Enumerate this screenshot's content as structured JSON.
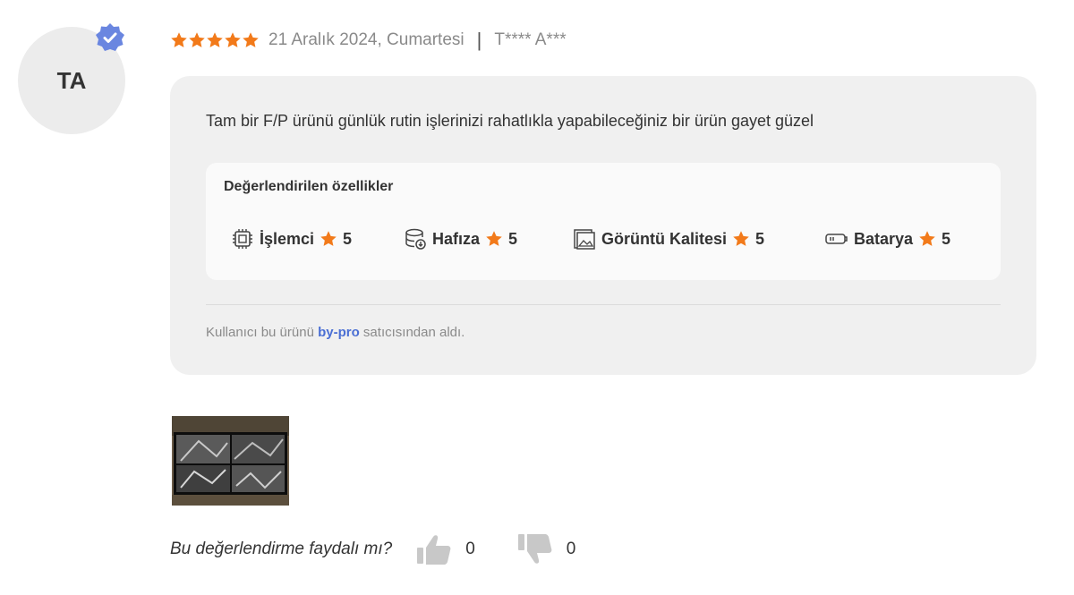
{
  "user": {
    "initials": "TA",
    "verified_icon": "verified-badge-icon",
    "masked_name": "T**** A***"
  },
  "review": {
    "rating": 5,
    "date": "21 Aralık 2024, Cumartesi",
    "separator": "|",
    "text": "Tam bir F/P ürünü günlük rutin işlerinizi rahatlıkla yapabileceğiniz bir ürün gayet güzel"
  },
  "features": {
    "title": "Değerlendirilen özellikler",
    "items": [
      {
        "icon": "cpu-icon",
        "label": "İşlemci",
        "score": "5"
      },
      {
        "icon": "storage-icon",
        "label": "Hafıza",
        "score": "5"
      },
      {
        "icon": "image-icon",
        "label": "Görüntü Kalitesi",
        "score": "5"
      },
      {
        "icon": "battery-icon",
        "label": "Batarya",
        "score": "5"
      }
    ]
  },
  "seller": {
    "prefix": "Kullanıcı bu ürünü ",
    "store": "by-pro",
    "suffix": " satıcısından aldı."
  },
  "helpful": {
    "question": "Bu değerlendirme faydalı mı?",
    "up_count": "0",
    "down_count": "0"
  },
  "colors": {
    "star": "#f27a1a",
    "accent": "#4a6fd4",
    "box_bg": "#f0f0f0",
    "vote_icon": "#c8c8c8"
  }
}
